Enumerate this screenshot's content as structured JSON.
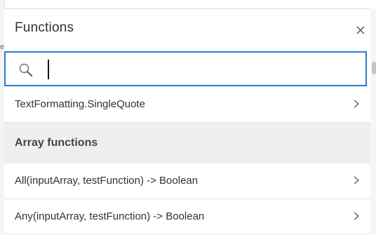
{
  "panel": {
    "title": "Functions",
    "close_icon": "close-icon"
  },
  "search": {
    "icon": "search-icon",
    "value": "",
    "placeholder": ""
  },
  "list": {
    "items": [
      {
        "label": "TextFormatting.SingleQuote",
        "icon": "chevron-right-icon"
      }
    ],
    "groups": [
      {
        "label": "Array functions",
        "items": [
          {
            "label": "All(inputArray, testFunction) -> Boolean",
            "icon": "chevron-right-icon"
          },
          {
            "label": "Any(inputArray, testFunction) -> Boolean",
            "icon": "chevron-right-icon"
          }
        ]
      }
    ]
  },
  "colors": {
    "accent": "#2b7bd1",
    "text": "#323232",
    "group_bg": "#efefef"
  }
}
